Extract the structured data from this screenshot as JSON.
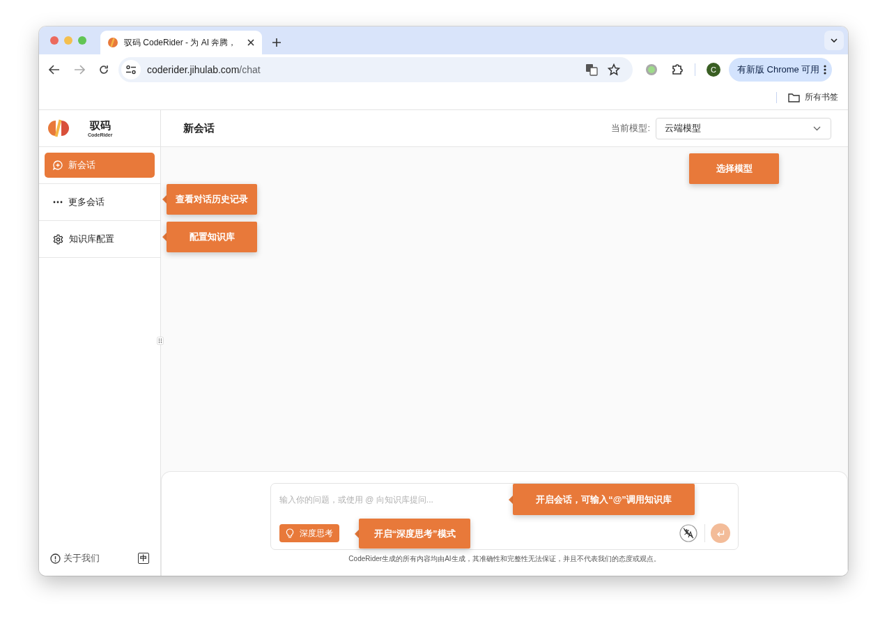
{
  "browser": {
    "tab": {
      "title": "驭码 CodeRider - 为 AI 奔腾，",
      "selected": true
    },
    "url_host": "coderider.jihulab.com",
    "url_path": "/chat",
    "profile_initial": "C",
    "update_button": "有新版 Chrome 可用",
    "bookmarks": "所有书签"
  },
  "sidebar": {
    "brand": "驭码",
    "brand_sub": "CodeRider",
    "items": [
      {
        "kind": "new",
        "label": "新会话",
        "selected": true
      },
      {
        "kind": "more",
        "label": "更多会话",
        "selected": false
      },
      {
        "kind": "settings",
        "label": "知识库配置",
        "selected": false
      }
    ],
    "about": "关于我们",
    "language_toggle": "中"
  },
  "header": {
    "title": "新会话",
    "model_label": "当前模型:",
    "model_value": "云端模型"
  },
  "composer": {
    "placeholder": "输入你的问题，或使用 @ 向知识库提问...",
    "deep_think": "深度思考",
    "send_disabled": true,
    "disclaimer": "CodeRider生成的所有内容均由AI生成，其准确性和完整性无法保证，并且不代表我们的态度或观点。"
  },
  "callouts": [
    {
      "text": "选择模型",
      "kind": "plain"
    },
    {
      "text": "查看对话历史记录",
      "kind": "arrow"
    },
    {
      "text": "配置知识库",
      "kind": "arrow"
    },
    {
      "text": "开启会话，可输入“@”调用知识库",
      "kind": "arrow"
    },
    {
      "text": "开启“深度思考”模式",
      "kind": "arrow"
    }
  ]
}
